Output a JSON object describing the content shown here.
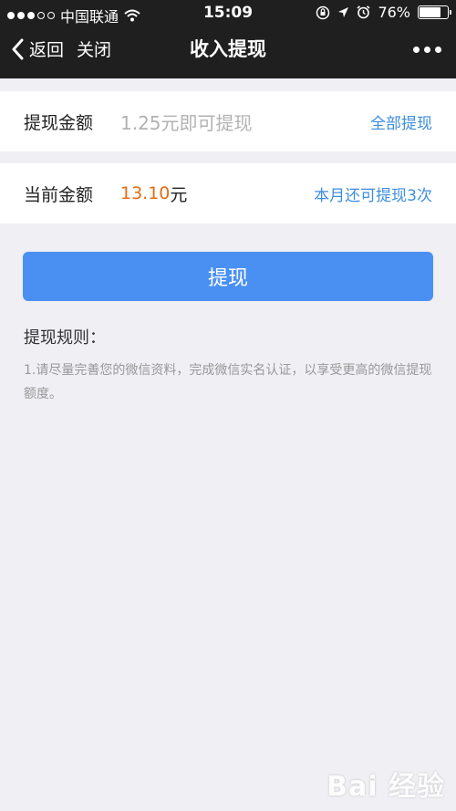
{
  "status_bar": {
    "carrier": "中国联通",
    "time": "15:09",
    "battery_percent_label": "76%",
    "battery_level": 0.76
  },
  "nav": {
    "back_label": "返回",
    "close_label": "关闭",
    "title": "收入提现"
  },
  "withdraw_amount": {
    "label": "提现金额",
    "placeholder": "1.25元即可提现",
    "all_link": "全部提现"
  },
  "current_amount": {
    "label": "当前金额",
    "value": "13.10",
    "unit": "元",
    "remaining_info": "本月还可提现3次"
  },
  "submit_button": {
    "label": "提现"
  },
  "rules": {
    "title": "提现规则：",
    "text": "1.请尽量完善您的微信资料，完成微信实名认证，以享受更高的微信提现额度。"
  },
  "colors": {
    "nav_background": "#1f1f1f",
    "accent_blue": "#4a90f2",
    "link_blue": "#3c8ede",
    "amount_orange": "#e86b10",
    "page_background": "#efeff4"
  },
  "watermark": {
    "text": "Bai 经验"
  }
}
